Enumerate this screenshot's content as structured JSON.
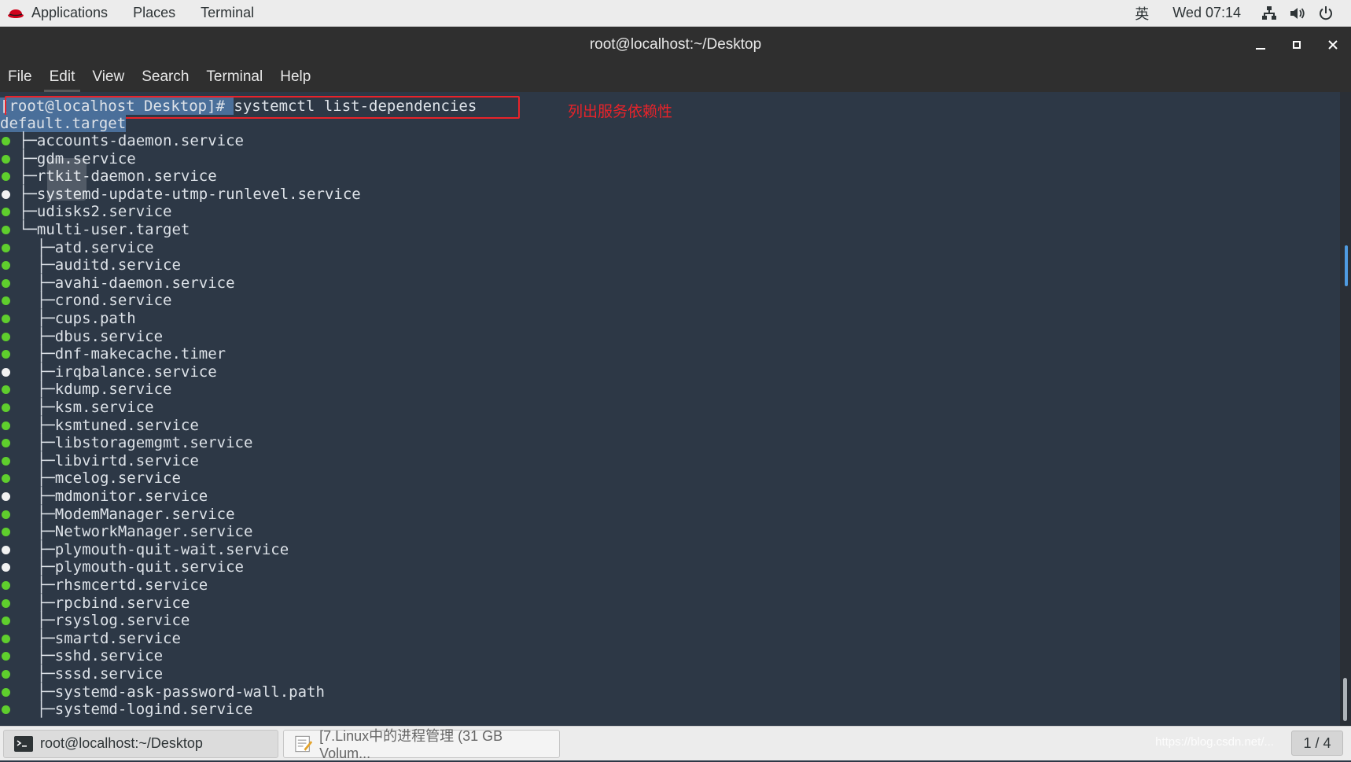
{
  "top_panel": {
    "applications": "Applications",
    "places": "Places",
    "terminal": "Terminal",
    "input_method": "英",
    "clock": "Wed 07:14",
    "icons": [
      "network-icon",
      "volume-icon",
      "power-icon"
    ]
  },
  "window": {
    "title": "root@localhost:~/Desktop"
  },
  "menubar": {
    "items": [
      "File",
      "Edit",
      "View",
      "Search",
      "Terminal",
      "Help"
    ]
  },
  "terminal": {
    "prompt": "[root@localhost Desktop]# ",
    "command": "systemctl list-dependencies",
    "annotation": "列出服务依赖性",
    "root_unit": "default.target",
    "units": [
      {
        "prefix": "├─",
        "name": "accounts-daemon.service",
        "status": "green"
      },
      {
        "prefix": "├─",
        "name": "gdm.service",
        "status": "green"
      },
      {
        "prefix": "├─",
        "name": "rtkit-daemon.service",
        "status": "green"
      },
      {
        "prefix": "├─",
        "name": "systemd-update-utmp-runlevel.service",
        "status": "white"
      },
      {
        "prefix": "├─",
        "name": "udisks2.service",
        "status": "green"
      },
      {
        "prefix": "└─",
        "name": "multi-user.target",
        "status": "green"
      },
      {
        "prefix": "  ├─",
        "name": "atd.service",
        "status": "green"
      },
      {
        "prefix": "  ├─",
        "name": "auditd.service",
        "status": "green"
      },
      {
        "prefix": "  ├─",
        "name": "avahi-daemon.service",
        "status": "green"
      },
      {
        "prefix": "  ├─",
        "name": "crond.service",
        "status": "green"
      },
      {
        "prefix": "  ├─",
        "name": "cups.path",
        "status": "green"
      },
      {
        "prefix": "  ├─",
        "name": "dbus.service",
        "status": "green"
      },
      {
        "prefix": "  ├─",
        "name": "dnf-makecache.timer",
        "status": "green"
      },
      {
        "prefix": "  ├─",
        "name": "irqbalance.service",
        "status": "white"
      },
      {
        "prefix": "  ├─",
        "name": "kdump.service",
        "status": "green"
      },
      {
        "prefix": "  ├─",
        "name": "ksm.service",
        "status": "green"
      },
      {
        "prefix": "  ├─",
        "name": "ksmtuned.service",
        "status": "green"
      },
      {
        "prefix": "  ├─",
        "name": "libstoragemgmt.service",
        "status": "green"
      },
      {
        "prefix": "  ├─",
        "name": "libvirtd.service",
        "status": "green"
      },
      {
        "prefix": "  ├─",
        "name": "mcelog.service",
        "status": "green"
      },
      {
        "prefix": "  ├─",
        "name": "mdmonitor.service",
        "status": "white"
      },
      {
        "prefix": "  ├─",
        "name": "ModemManager.service",
        "status": "green"
      },
      {
        "prefix": "  ├─",
        "name": "NetworkManager.service",
        "status": "green"
      },
      {
        "prefix": "  ├─",
        "name": "plymouth-quit-wait.service",
        "status": "white"
      },
      {
        "prefix": "  ├─",
        "name": "plymouth-quit.service",
        "status": "white"
      },
      {
        "prefix": "  ├─",
        "name": "rhsmcertd.service",
        "status": "green"
      },
      {
        "prefix": "  ├─",
        "name": "rpcbind.service",
        "status": "green"
      },
      {
        "prefix": "  ├─",
        "name": "rsyslog.service",
        "status": "green"
      },
      {
        "prefix": "  ├─",
        "name": "smartd.service",
        "status": "green"
      },
      {
        "prefix": "  ├─",
        "name": "sshd.service",
        "status": "green"
      },
      {
        "prefix": "  ├─",
        "name": "sssd.service",
        "status": "green"
      },
      {
        "prefix": "  ├─",
        "name": "systemd-ask-password-wall.path",
        "status": "green"
      },
      {
        "prefix": "  ├─",
        "name": "systemd-logind.service",
        "status": "green"
      }
    ]
  },
  "colors": {
    "status_active": "#5fce2d",
    "status_inactive": "#f2f2f2",
    "annotation": "#e8232a",
    "terminal_bg": "#2d3846"
  },
  "taskbar": {
    "tasks": [
      {
        "label": "root@localhost:~/Desktop",
        "icon": "terminal-icon",
        "active": true
      },
      {
        "label": "[7.Linux中的进程管理 (31 GB Volum...",
        "icon": "text-editor-icon",
        "active": false
      }
    ],
    "watermark": "https://blog.csdn.net/...",
    "pager": "1 / 4"
  }
}
